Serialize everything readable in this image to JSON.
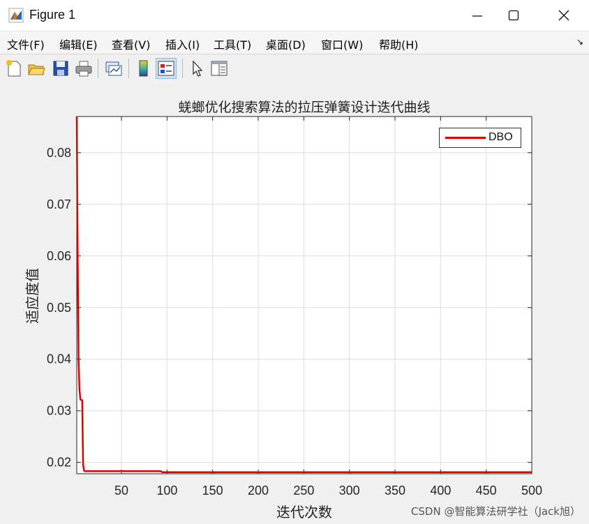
{
  "window": {
    "title": "Figure 1",
    "buttons": {
      "minimize": "minimize-icon",
      "maximize": "maximize-icon",
      "close": "close-icon"
    }
  },
  "menu": {
    "items": [
      "文件(F)",
      "编辑(E)",
      "查看(V)",
      "插入(I)",
      "工具(T)",
      "桌面(D)",
      "窗口(W)",
      "帮助(H)"
    ]
  },
  "toolbar": {
    "icons": [
      "new-figure-icon",
      "open-file-icon",
      "save-icon",
      "print-icon",
      "link-plot-icon",
      "insert-colorbar-icon",
      "insert-legend-icon",
      "edit-plot-arrow-icon",
      "property-inspector-icon"
    ]
  },
  "colors": {
    "line": "#e00000",
    "grid": "#dfdfdf",
    "axes_bg": "#ffffff"
  },
  "watermark": "CSDN @智能算法研学社（Jack旭）",
  "chart_data": {
    "type": "line",
    "title": "蜣螂优化搜索算法的拉压弹簧设计迭代曲线",
    "xlabel": "迭代次数",
    "ylabel": "适应度值",
    "xlim": [
      1,
      500
    ],
    "ylim": [
      0.0178,
      0.087
    ],
    "xticks": [
      50,
      100,
      150,
      200,
      250,
      300,
      350,
      400,
      450,
      500
    ],
    "yticks": [
      0.02,
      0.03,
      0.04,
      0.05,
      0.06,
      0.07,
      0.08
    ],
    "ytick_labels": [
      "0.02",
      "0.03",
      "0.04",
      "0.05",
      "0.06",
      "0.07",
      "0.08"
    ],
    "grid": true,
    "legend_position": "top-right",
    "series": [
      {
        "name": "DBO",
        "color": "#e00000",
        "x": [
          1,
          2,
          3,
          4,
          5,
          7,
          8,
          9,
          10,
          20,
          50,
          93,
          95,
          100,
          200,
          300,
          400,
          500
        ],
        "y": [
          0.087,
          0.06,
          0.04,
          0.034,
          0.0322,
          0.032,
          0.0195,
          0.0184,
          0.0183,
          0.0183,
          0.0183,
          0.0183,
          0.0181,
          0.0181,
          0.0181,
          0.0181,
          0.0181,
          0.0181
        ]
      }
    ]
  }
}
